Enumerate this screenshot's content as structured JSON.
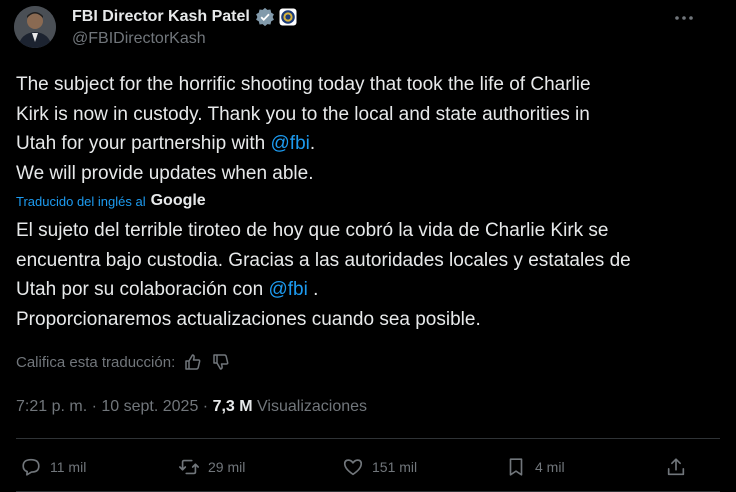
{
  "author": {
    "display_name": "FBI Director Kash Patel",
    "handle": "@FBIDirectorKash"
  },
  "tweet": {
    "original": {
      "line1": "The subject for the horrific shooting today that took the life of Charlie",
      "line2": "Kirk is now in custody. Thank you to the local and state authorities in",
      "line3_pre": "Utah for your partnership with ",
      "line3_mention": "@fbi",
      "line3_post": ".",
      "line4": "We will provide updates when able."
    },
    "translation_attribution": {
      "label": "Traducido del inglés al",
      "provider": "Google"
    },
    "translated": {
      "line1": "El sujeto del terrible tiroteo de hoy que cobró la vida de Charlie Kirk se",
      "line2": "encuentra bajo custodia. Gracias a las autoridades locales y estatales de",
      "line3_pre": "Utah por su colaboración con ",
      "line3_mention": "@fbi",
      "line3_post": " .",
      "line4": "Proporcionaremos actualizaciones cuando sea posible."
    },
    "rate_translation_label": "Califica esta traducción:",
    "timestamp": "7:21 p. m. · 10 sept. 2025 · ",
    "views_count": "7,3 M",
    "views_label": " Visualizaciones"
  },
  "actions": {
    "replies": "11 mil",
    "reposts": "29 mil",
    "likes": "151 mil",
    "bookmarks": "4 mil"
  },
  "colors": {
    "background": "#000000",
    "text": "#e7e9ea",
    "muted": "#71767b",
    "link": "#1d9bf0",
    "divider": "#2f3336"
  }
}
